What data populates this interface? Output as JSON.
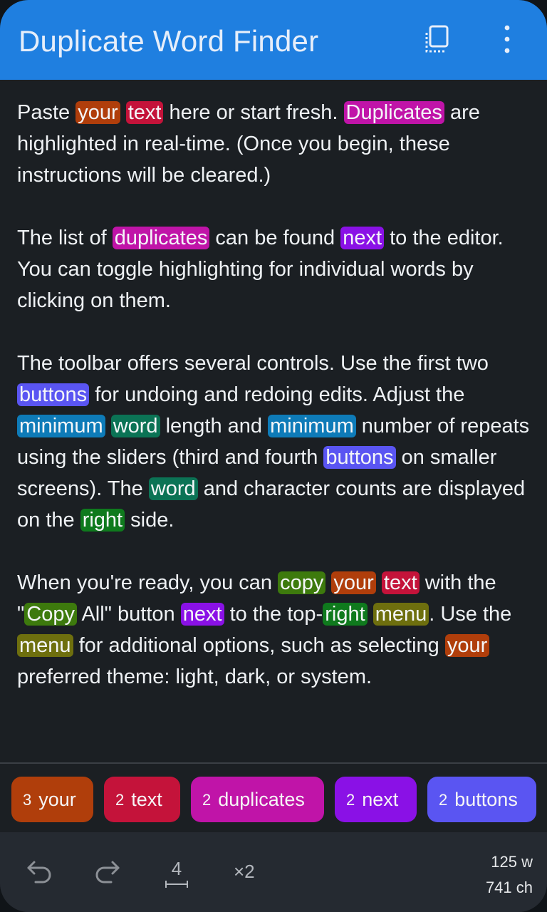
{
  "appbar": {
    "title": "Duplicate Word Finder",
    "copy_icon": "copy-icon",
    "menu_icon": "more-vert-icon"
  },
  "editor": {
    "paragraphs": [
      [
        {
          "t": "Paste "
        },
        {
          "t": "your",
          "c": "#b03e0b"
        },
        {
          "t": " "
        },
        {
          "t": "text",
          "c": "#c4133a"
        },
        {
          "t": " here or start fresh. "
        },
        {
          "t": "Duplicates",
          "c": "#c014a8"
        },
        {
          "t": " are highlighted in real-time. (Once you begin, these instructions will be cleared.)"
        }
      ],
      [
        {
          "t": "The list of "
        },
        {
          "t": "duplicates",
          "c": "#c014a8"
        },
        {
          "t": " can be found "
        },
        {
          "t": "next",
          "c": "#8a11e6"
        },
        {
          "t": " to the editor. You can toggle highlighting for individual words by clicking on them."
        }
      ],
      [
        {
          "t": "The toolbar offers several controls. Use the first two "
        },
        {
          "t": "buttons",
          "c": "#5a55f2"
        },
        {
          "t": " for undoing and redoing edits. Adjust the "
        },
        {
          "t": "minimum",
          "c": "#0e7bb8"
        },
        {
          "t": " "
        },
        {
          "t": "word",
          "c": "#0b7355"
        },
        {
          "t": " length and "
        },
        {
          "t": "minimum",
          "c": "#0e7bb8"
        },
        {
          "t": " number of repeats using the sliders (third and fourth "
        },
        {
          "t": "buttons",
          "c": "#5a55f2"
        },
        {
          "t": " on smaller screens). The "
        },
        {
          "t": "word",
          "c": "#0b7355"
        },
        {
          "t": " and character counts are displayed on the "
        },
        {
          "t": "right",
          "c": "#0f7a1d"
        },
        {
          "t": " side."
        }
      ],
      [
        {
          "t": "When you're ready, you can "
        },
        {
          "t": "copy",
          "c": "#3d7a0d"
        },
        {
          "t": " "
        },
        {
          "t": "your",
          "c": "#b03e0b"
        },
        {
          "t": " "
        },
        {
          "t": "text",
          "c": "#c4133a"
        },
        {
          "t": " with the \""
        },
        {
          "t": "Copy",
          "c": "#3d7a0d"
        },
        {
          "t": " All\" button "
        },
        {
          "t": "next",
          "c": "#8a11e6"
        },
        {
          "t": " to the top-"
        },
        {
          "t": "right",
          "c": "#0f7a1d"
        },
        {
          "t": " "
        },
        {
          "t": "menu",
          "c": "#6e6f0e"
        },
        {
          "t": ". Use the "
        },
        {
          "t": "menu",
          "c": "#6e6f0e"
        },
        {
          "t": " for additional options, such as selecting "
        },
        {
          "t": "your",
          "c": "#b03e0b"
        },
        {
          "t": " preferred theme: light, dark, or system."
        }
      ]
    ]
  },
  "chips": [
    {
      "count": "3",
      "word": "your",
      "color": "#b03e0b"
    },
    {
      "count": "2",
      "word": "text",
      "color": "#c4133a"
    },
    {
      "count": "2",
      "word": "duplicates",
      "color": "#c014a8"
    },
    {
      "count": "2",
      "word": "next",
      "color": "#8a11e6"
    },
    {
      "count": "2",
      "word": "buttons",
      "color": "#5a55f2"
    }
  ],
  "toolbar": {
    "undo_icon": "undo-icon",
    "redo_icon": "redo-icon",
    "min_length": "4",
    "min_repeats": "×2",
    "word_count": "125 w",
    "char_count": "741 ch"
  }
}
